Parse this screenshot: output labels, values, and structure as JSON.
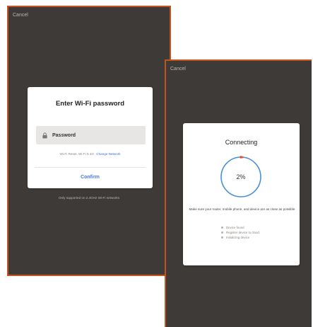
{
  "wifi_screen": {
    "cancel_label": "Cancel",
    "dialog": {
      "title": "Enter Wi-Fi password",
      "password_placeholder": "Password",
      "network_info": "Wi-Fi Reset, Wi-Fi 5 4G",
      "change_network_label": "Change Network",
      "confirm_label": "Confirm"
    },
    "support_note": "Only supported on 2.4GHz Wi-Fi networks"
  },
  "connecting_screen": {
    "cancel_label": "Cancel",
    "dialog": {
      "title": "Connecting",
      "progress_percent": 2,
      "progress_text": "2%",
      "hint": "Make sure your router, mobile phone, and device are as close as possible",
      "steps": [
        "Device found",
        "Register device to cloud",
        "Initializing device"
      ]
    }
  },
  "colors": {
    "screen_background": "#3e3a37",
    "frame_border": "#c4521f",
    "progress_ring": "#4a90d9",
    "progress_accent": "#e0533a",
    "link_blue": "#3a6fd1"
  },
  "icons": {
    "password_field": "lock-icon"
  }
}
